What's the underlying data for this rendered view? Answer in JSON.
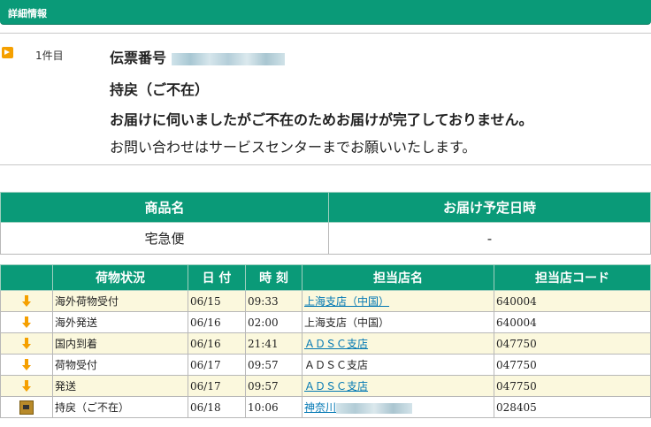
{
  "header": {
    "title": "詳細情報"
  },
  "item": {
    "count": "1件目",
    "label": "伝票番号",
    "status": "持戻（ご不在）",
    "message": "お届けに伺いましたがご不在のためお届けが完了しておりません。",
    "note": "お問い合わせはサービスセンターまでお願いいたします。"
  },
  "product_table": {
    "headers": [
      "商品名",
      "お届け予定日時"
    ],
    "row": [
      "宅急便",
      "-"
    ]
  },
  "history_table": {
    "headers": [
      "荷物状況",
      "日 付",
      "時 刻",
      "担当店名",
      "担当店コード"
    ],
    "rows": [
      {
        "status": "海外荷物受付",
        "date": "06/15",
        "time": "09:33",
        "store": "上海支店（中国）",
        "code": "640004"
      },
      {
        "status": "海外発送",
        "date": "06/16",
        "time": "02:00",
        "store": "上海支店（中国）",
        "code": "640004"
      },
      {
        "status": "国内到着",
        "date": "06/16",
        "time": "21:41",
        "store": "ＡＤＳＣ支店",
        "code": "047750"
      },
      {
        "status": "荷物受付",
        "date": "06/17",
        "time": "09:57",
        "store": "ＡＤＳＣ支店",
        "code": "047750"
      },
      {
        "status": "発送",
        "date": "06/17",
        "time": "09:57",
        "store": "ＡＤＳＣ支店",
        "code": "047750"
      },
      {
        "status": "持戻（ご不在）",
        "date": "06/18",
        "time": "10:06",
        "store": "神奈川",
        "code": "028405"
      }
    ]
  },
  "colors": {
    "accent": "#0a9a78",
    "arrow": "#f5a000",
    "link": "#0077b3",
    "row_alt": "#fbf8dd"
  }
}
